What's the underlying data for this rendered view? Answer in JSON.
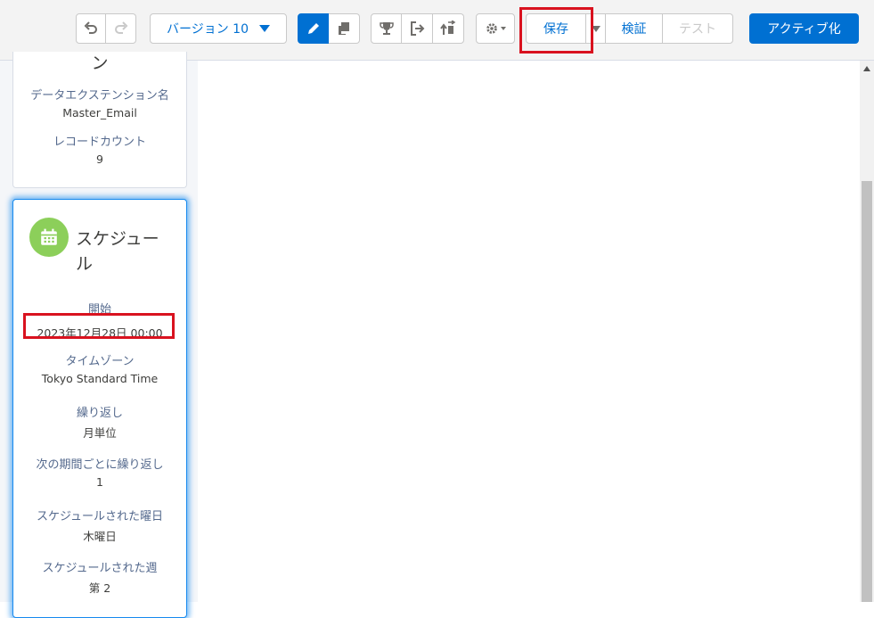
{
  "toolbar": {
    "version_label": "バージョン 10",
    "save_label": "保存",
    "validate_label": "検証",
    "test_label": "テスト",
    "activate_label": "アクティブ化"
  },
  "data_card": {
    "title_fragment": "ン",
    "de_name_label": "データエクステンション名",
    "de_name_value": "Master_Email",
    "record_count_label": "レコードカウント",
    "record_count_value": "9"
  },
  "schedule_card": {
    "title_line1": "スケジュー",
    "title_line2": "ル",
    "start_label": "開始",
    "start_value": "2023年12月28日 00:00",
    "timezone_label": "タイムゾーン",
    "timezone_value": "Tokyo Standard Time",
    "repeat_label": "繰り返し",
    "repeat_value": "月単位",
    "interval_label": "次の期間ごとに繰り返し",
    "interval_value": "1",
    "weekday_label": "スケジュールされた曜日",
    "weekday_value": "木曜日",
    "week_label": "スケジュールされた週",
    "week_value": "第 2"
  },
  "icons": [
    "undo-icon",
    "redo-icon",
    "pencil-icon",
    "copy-icon",
    "trophy-icon",
    "exit-icon",
    "swap-icon",
    "gear-icon",
    "calendar-icon"
  ],
  "colors": {
    "brand": "#0070d2",
    "highlight": "#d9121f",
    "schedule_icon": "#8ccf5a"
  }
}
